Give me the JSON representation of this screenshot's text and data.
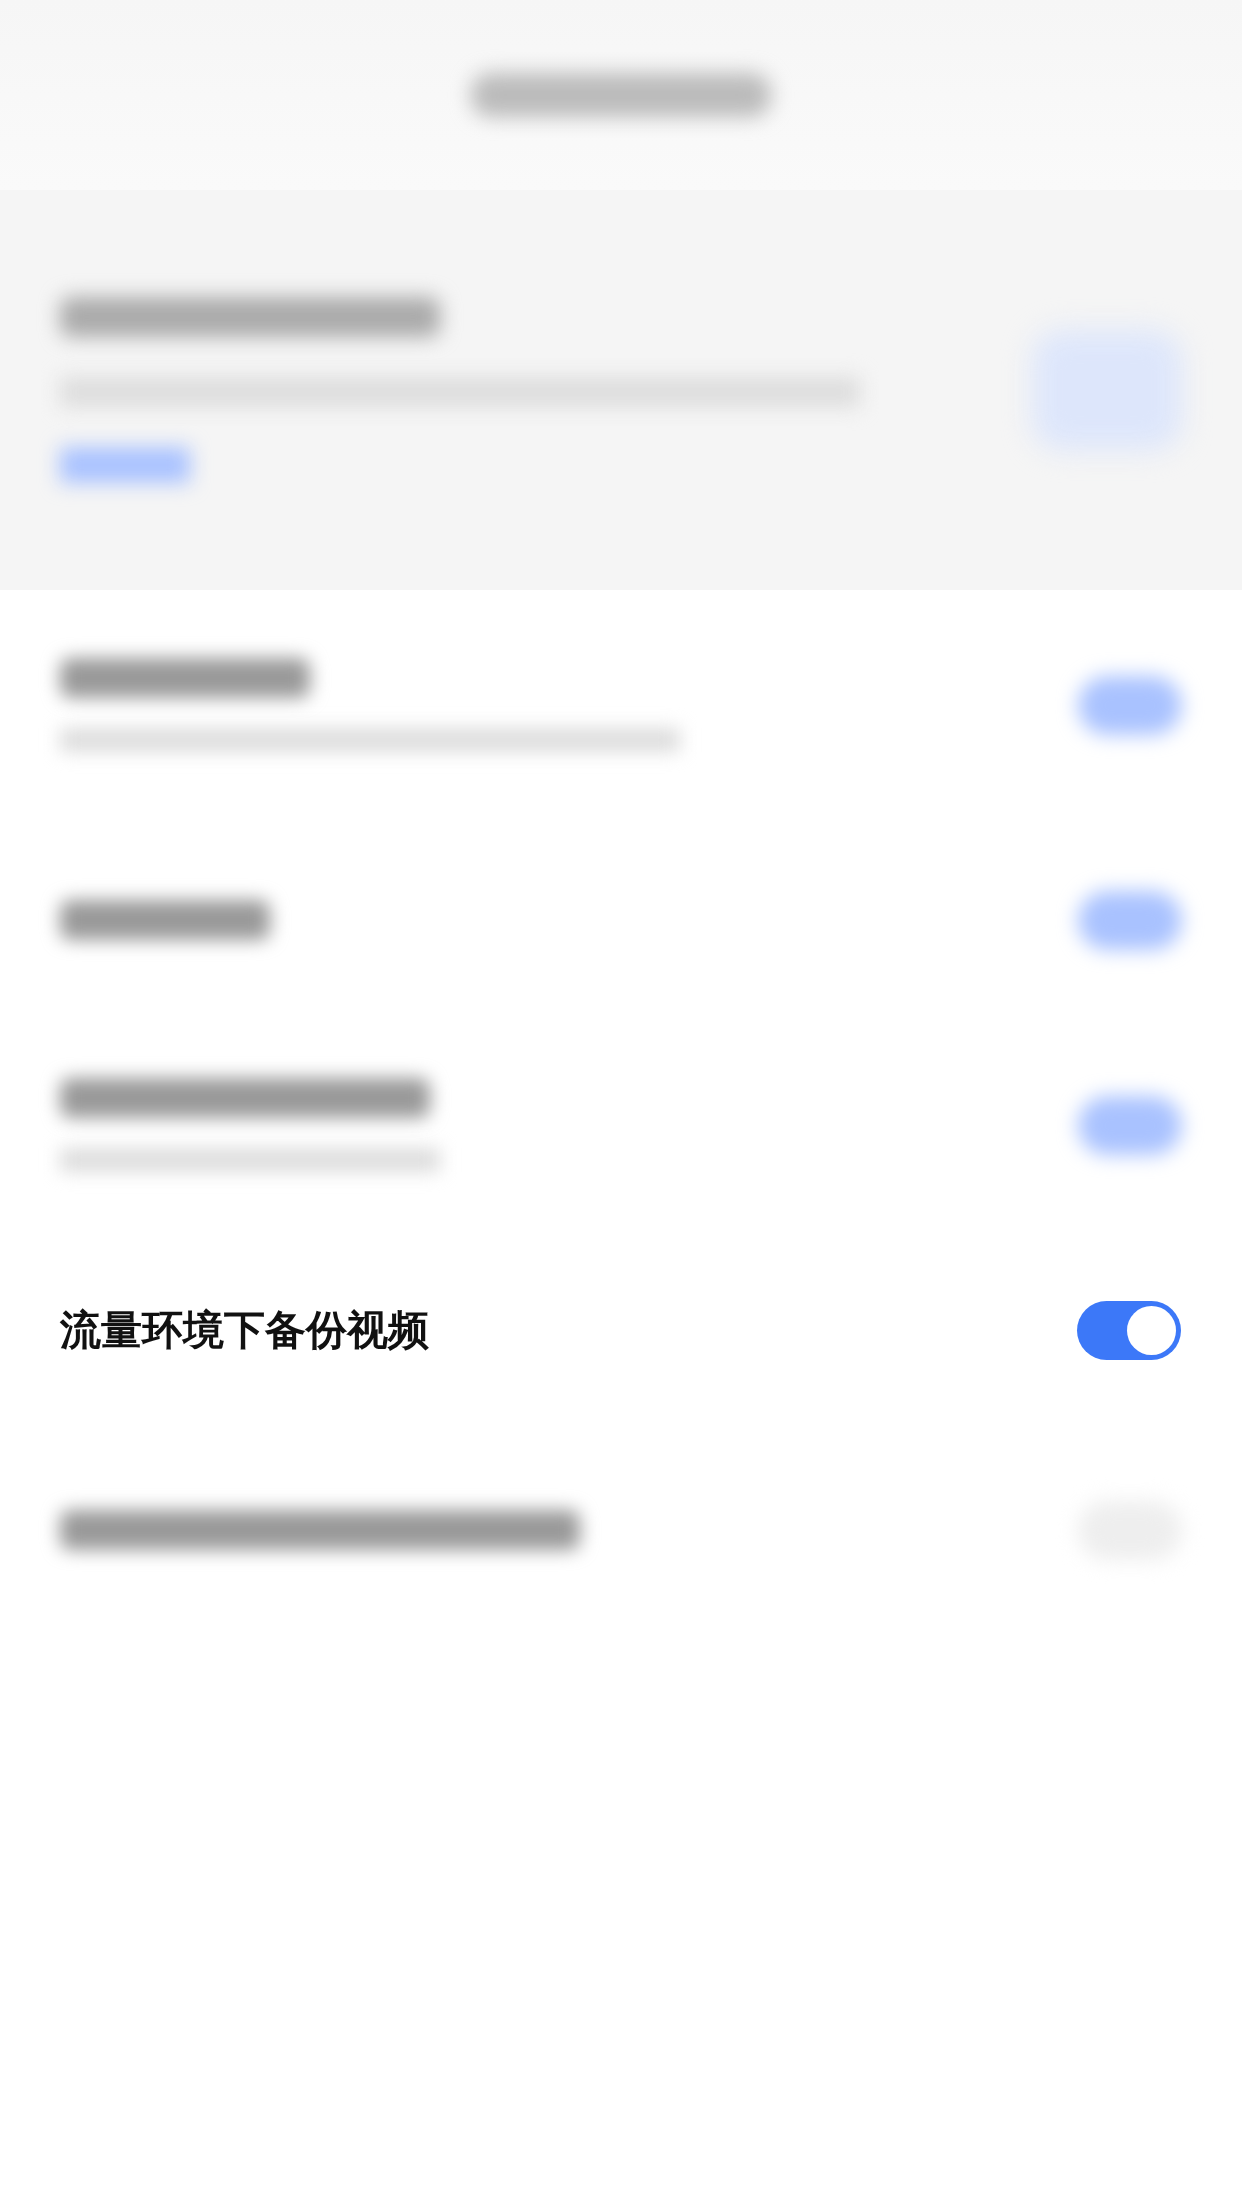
{
  "blurred_rows": [
    {
      "on": true
    },
    {
      "on": true
    },
    {
      "on": true
    }
  ],
  "setting": {
    "label": "流量环境下备份视频",
    "on": true
  },
  "blurred_rows_below": [
    {
      "on": false
    }
  ]
}
